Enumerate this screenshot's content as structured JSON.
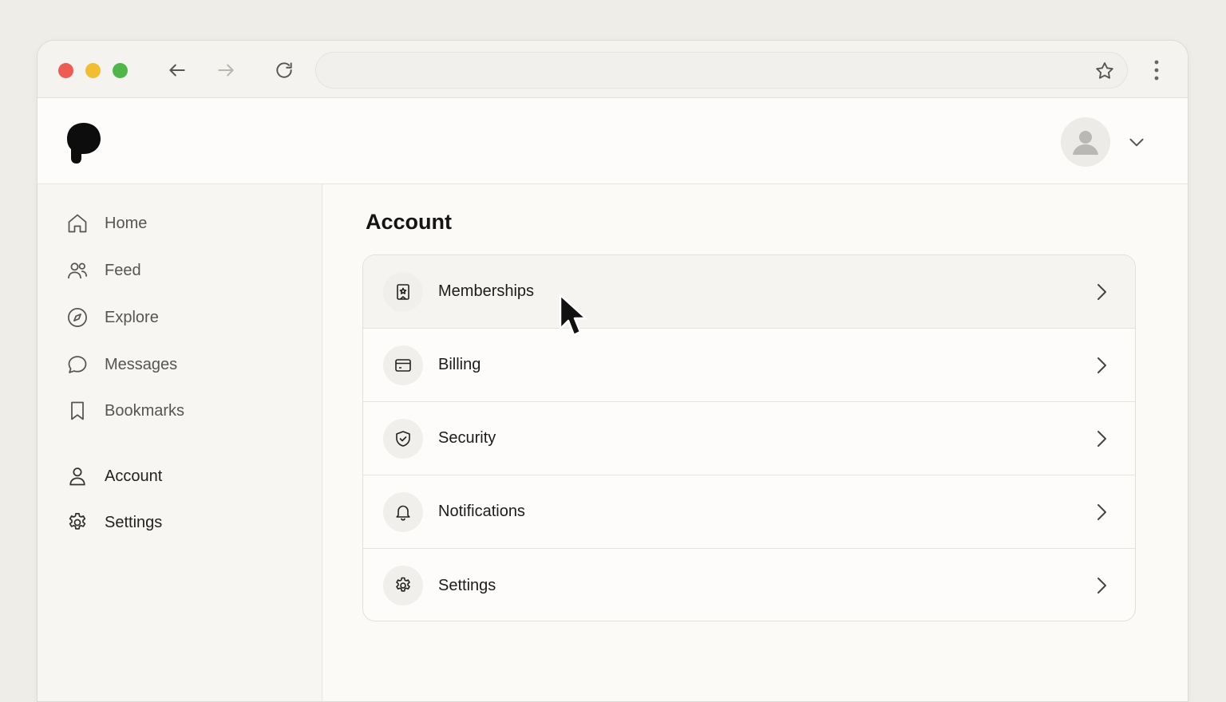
{
  "colors": {
    "traffic_red": "#ee5b52",
    "traffic_yellow": "#f3bd32",
    "traffic_green": "#4fb74a",
    "accent": "#141414"
  },
  "browser": {
    "address_value": "",
    "icons": [
      "back-arrow-icon",
      "forward-arrow-icon",
      "reload-icon",
      "star-icon",
      "kebab-menu-icon"
    ]
  },
  "header": {
    "logo": "brand-logo",
    "avatar": "user-avatar-icon"
  },
  "sidebar": {
    "items": [
      {
        "label": "Home",
        "icon": "home-icon"
      },
      {
        "label": "Feed",
        "icon": "users-icon"
      },
      {
        "label": "Explore",
        "icon": "compass-icon"
      },
      {
        "label": "Messages",
        "icon": "chat-bubble-icon"
      },
      {
        "label": "Bookmarks",
        "icon": "bookmark-icon"
      },
      {
        "label": "Account",
        "icon": "user-icon"
      },
      {
        "label": "Settings",
        "icon": "gear-icon"
      }
    ]
  },
  "main": {
    "title": "Account",
    "rows": [
      {
        "label": "Memberships",
        "icon": "membership-badge-icon"
      },
      {
        "label": "Billing",
        "icon": "credit-card-icon"
      },
      {
        "label": "Security",
        "icon": "shield-icon"
      },
      {
        "label": "Notifications",
        "icon": "bell-icon"
      },
      {
        "label": "Settings",
        "icon": "gear-icon"
      }
    ]
  }
}
